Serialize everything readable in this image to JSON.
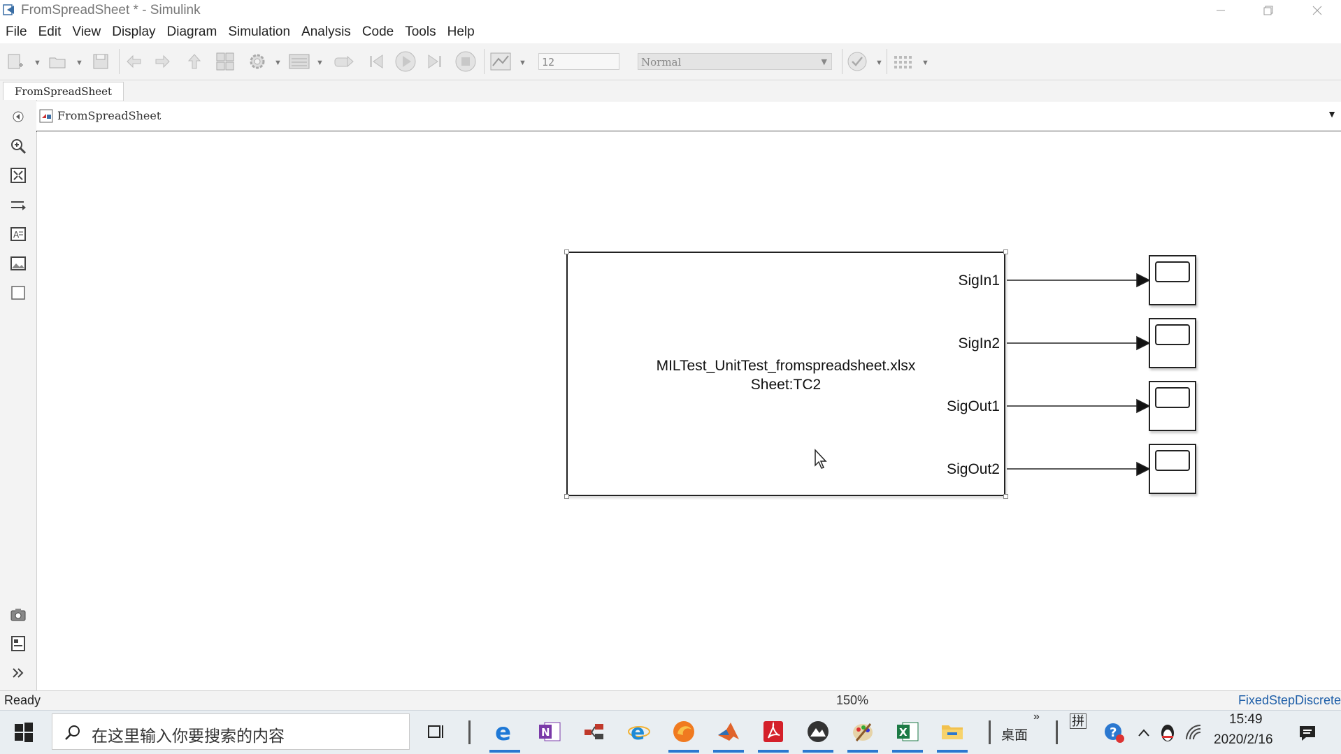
{
  "window": {
    "title": "FromSpreadSheet * - Simulink",
    "controls": [
      "minimize",
      "restore",
      "close"
    ]
  },
  "menu": [
    "File",
    "Edit",
    "View",
    "Display",
    "Diagram",
    "Simulation",
    "Analysis",
    "Code",
    "Tools",
    "Help"
  ],
  "toolbar": {
    "stop_time": "12",
    "sim_mode": "Normal"
  },
  "tabs": [
    {
      "label": "FromSpreadSheet",
      "active": true
    }
  ],
  "address": {
    "path": "FromSpreadSheet"
  },
  "diagram": {
    "block": {
      "line1": "MILTest_UnitTest_fromspreadsheet.xlsx",
      "line2": "Sheet:TC2",
      "ports": [
        "SigIn1",
        "SigIn2",
        "SigOut1",
        "SigOut2"
      ]
    },
    "scopes": 4
  },
  "status": {
    "left": "Ready",
    "zoom": "150%",
    "solver": "FixedStepDiscrete"
  },
  "taskbar": {
    "search_placeholder": "在这里输入你要搜索的内容",
    "desktop_label": "桌面",
    "ime_label": "拼",
    "time": "15:49",
    "date": "2020/2/16"
  },
  "colors": {
    "accent": "#2b78d0",
    "toolbar_bg": "#f3f3f3",
    "taskbar_bg": "#e9eef2"
  }
}
